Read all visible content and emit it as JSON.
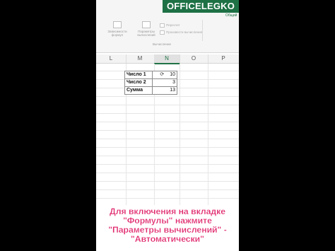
{
  "brand": {
    "label": "OFFICELEGKO"
  },
  "ribbon": {
    "tab_hint": "Общий",
    "group_label": "Вычисление",
    "buttons": [
      {
        "label": "Зависимости формул"
      },
      {
        "label": "Параметры вычислений"
      }
    ],
    "small_items": [
      {
        "label": "Пересчет"
      },
      {
        "label": "Произвести вычисления"
      }
    ]
  },
  "columns": [
    {
      "letter": "L"
    },
    {
      "letter": "M"
    },
    {
      "letter": "N"
    },
    {
      "letter": "O"
    },
    {
      "letter": "P"
    }
  ],
  "table": {
    "rows": [
      {
        "label": "Число 1",
        "value": "10"
      },
      {
        "label": "Число 2",
        "value": "3"
      },
      {
        "label": "Сумма",
        "value": "13"
      }
    ]
  },
  "caption": {
    "line1": "Для включения на вкладке",
    "line2": "\"Формулы\" нажмите",
    "line3": "\"Параметры вычислений\" -",
    "line4": "\"Автоматически\""
  }
}
